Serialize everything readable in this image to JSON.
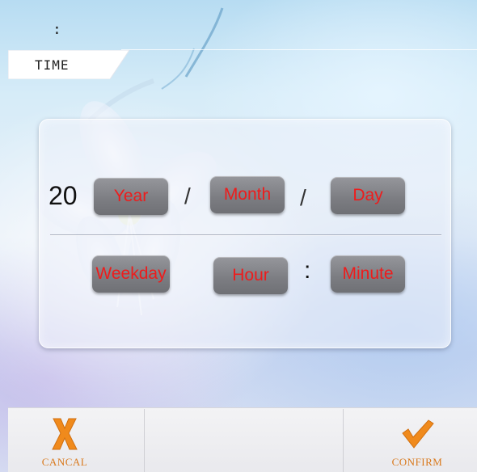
{
  "header": {
    "status_text": ":",
    "tab_label": "TIME"
  },
  "date_row": {
    "year_prefix": "20",
    "year_label": "Year",
    "separator_1": "/",
    "month_label": "Month",
    "separator_2": "/",
    "day_label": "Day"
  },
  "time_row": {
    "weekday_label": "Weekday",
    "hour_label": "Hour",
    "separator": ":",
    "minute_label": "Minute"
  },
  "footer": {
    "cancel_label": "CANCAL",
    "cancel_icon": "close-x-icon",
    "confirm_label": "CONFIRM",
    "confirm_icon": "checkmark-icon"
  },
  "colors": {
    "field_text": "#ee1c1c",
    "footer_text": "#d9791d",
    "icon_orange": "#f08a1c"
  }
}
